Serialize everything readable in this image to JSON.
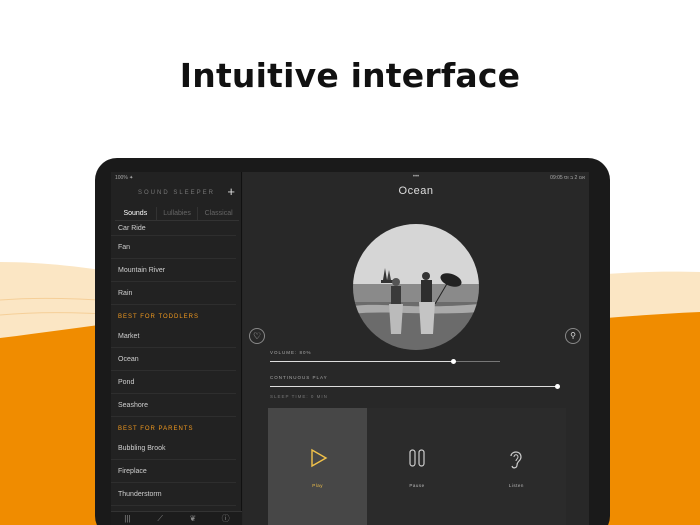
{
  "headline": "Intuitive interface",
  "colors": {
    "accent": "#f29a1f",
    "play_active": "#f2c24a",
    "banner": "#f08c00",
    "banner_light": "#fbe6c4"
  },
  "status": {
    "left": "100% ✦",
    "center": "•••",
    "right": "אנו 2 ב וס 09:05"
  },
  "sidebar": {
    "logo": "SOUND SLEEPER",
    "add_icon": "plus-icon",
    "segments": [
      "Sounds",
      "Lullabies",
      "Classical"
    ],
    "active_segment": "Sounds",
    "list": [
      {
        "type": "item",
        "label": "Car Ride"
      },
      {
        "type": "item",
        "label": "Fan"
      },
      {
        "type": "item",
        "label": "Mountain River"
      },
      {
        "type": "item",
        "label": "Rain"
      },
      {
        "type": "section",
        "label": "BEST FOR TODDLERS"
      },
      {
        "type": "item",
        "label": "Market"
      },
      {
        "type": "item",
        "label": "Ocean"
      },
      {
        "type": "item",
        "label": "Pond"
      },
      {
        "type": "item",
        "label": "Seashore"
      },
      {
        "type": "section",
        "label": "BEST FOR PARENTS"
      },
      {
        "type": "item",
        "label": "Bubbling Brook"
      },
      {
        "type": "item",
        "label": "Fireplace"
      },
      {
        "type": "item",
        "label": "Thunderstorm"
      }
    ],
    "tabbar_icons": [
      "bars-icon",
      "graph-icon",
      "leaf-icon",
      "info-icon"
    ]
  },
  "player": {
    "title": "Ocean",
    "favorite_icon": "heart-icon",
    "timer_icon": "timer-icon",
    "volume_label": "VOLUME: 80%",
    "volume": 0.8,
    "continuous_label": "CONTINUOUS PLAY",
    "continuous_level": 1.0,
    "sleep_label": "SLEEP TIME: 0 MIN",
    "controls": [
      {
        "label": "Play",
        "icon": "play-icon",
        "active": true
      },
      {
        "label": "Pause",
        "icon": "pause-icon",
        "active": false
      },
      {
        "label": "Listen",
        "icon": "ear-icon",
        "active": false
      }
    ]
  }
}
